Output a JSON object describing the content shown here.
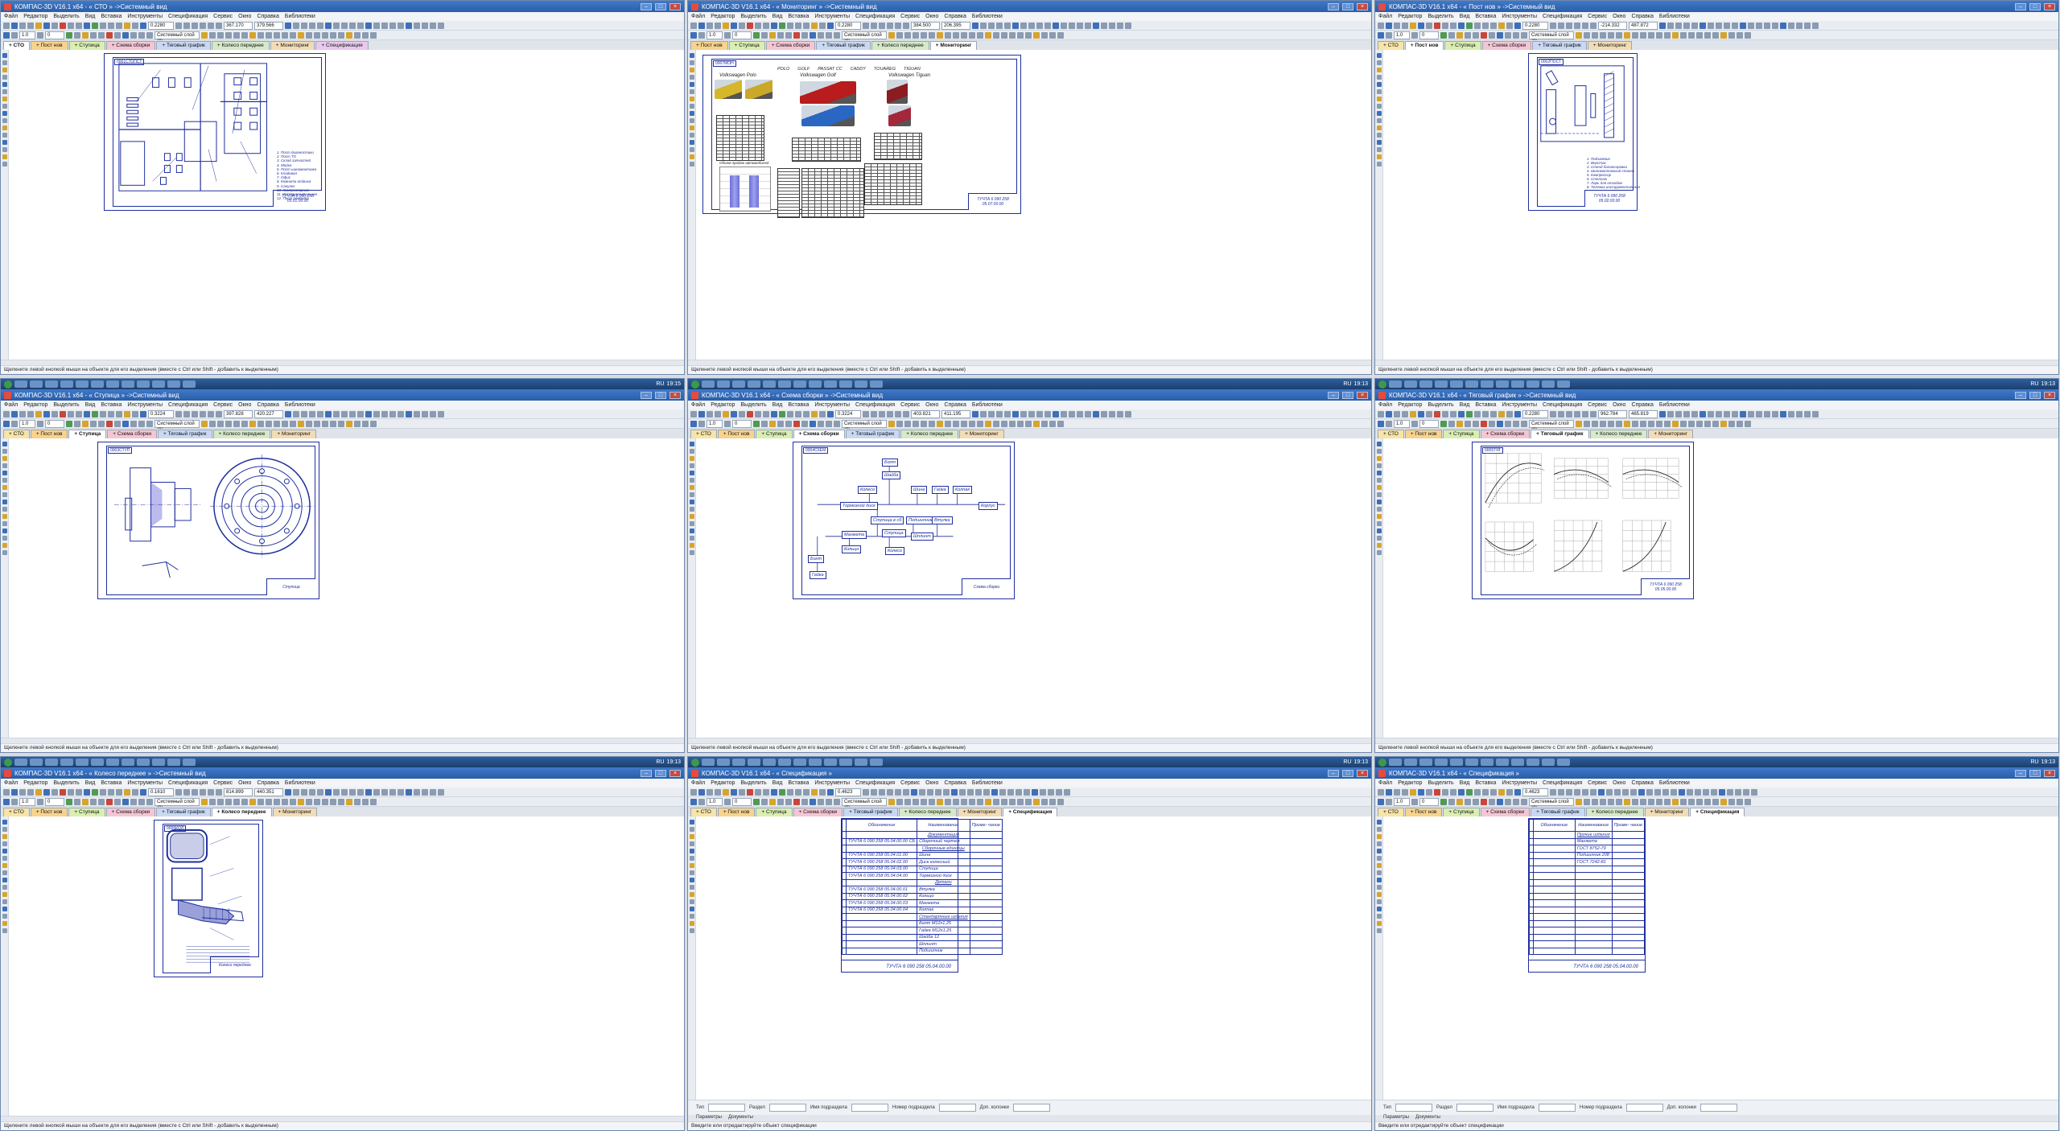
{
  "app": {
    "menu": [
      "Файл",
      "Редактор",
      "Выделить",
      "Вид",
      "Вставка",
      "Инструменты",
      "Спецификация",
      "Сервис",
      "Окно",
      "Справка",
      "Библиотеки"
    ],
    "status_select": "Щелкните левой кнопкой мыши на объекте для его выделения (вместе с Ctrl или Shift - добавить к выделенным)",
    "status_spec": "Введите или отредактируйте объект спецификации",
    "layer": "Системный слой (0)",
    "step": "1.0",
    "angle": "0",
    "lang": "RU",
    "tab_labels": [
      "+ СТО",
      "+ Пост нов",
      "+ Ступица",
      "+ Схема сборки",
      "+ Тяговый график",
      "+ Колесо переднее",
      "+ Мониторинг",
      "+ Спецификация"
    ],
    "spec_panel": [
      "Тип",
      "Раздел",
      "Имя подраздела",
      "Номер подраздела",
      "Доп. колонки"
    ],
    "spec_tabs": [
      "Параметры",
      "Документы"
    ],
    "colors": {
      "frame": "#1f2f9e",
      "title": "#2a5ea8",
      "taskbar": "#1c3f70"
    }
  },
  "windows": [
    {
      "title": "КОМПАС-3D V16.1 x64 - « СТО » ->Системный вид",
      "zoom": "0.2280",
      "coords": [
        "367.170",
        "379.566"
      ],
      "active": 0,
      "tabs": [
        0,
        1,
        2,
        3,
        4,
        5,
        6,
        7
      ],
      "type": "plan",
      "stamp": "ТУЧТА 6 090 258 05.01.00.00",
      "tag": "0001СТОПСТ",
      "status": "select",
      "taskbar": false,
      "plan_items": [
        "1. Пост диагностики",
        "2. Пост ТО",
        "3. Склад запчастей",
        "4. Мойка",
        "5. Пост шиномонтажа",
        "6. Кладовая",
        "7. Офис",
        "8. Комната отдыха",
        "9. Санузел",
        "10. Компрессорная",
        "11. Инструментальная",
        "12. Пост ремонта"
      ]
    },
    {
      "title": "КОМПАС-3D V16.1 x64 - « Мониторинг » ->Системный вид",
      "zoom": "0.2280",
      "coords": [
        "384.500",
        "206.395"
      ],
      "active": 6,
      "tabs": [
        1,
        2,
        3,
        4,
        5,
        6
      ],
      "type": "monitor",
      "stamp": "ТУЧТА 6 090 258 05.07.00.00",
      "tag": "0007МОН",
      "status": "select",
      "taskbar": false,
      "cars": [
        "Volkswagen Polo",
        "Volkswagen Golf",
        "Volkswagen Tiguan"
      ],
      "brands": [
        "POLO",
        "GOLF",
        "PASSAT CC",
        "CADDY",
        "TOUAREG",
        "TIGUAN"
      ],
      "chart_caption": "Объем продаж автомобилей"
    },
    {
      "title": "КОМПАС-3D V16.1 x64 - « Пост нов » ->Системный вид",
      "zoom": "0.2280",
      "coords": [
        "-214.332",
        "487.872"
      ],
      "active": 1,
      "tabs": [
        0,
        1,
        2,
        3,
        4,
        6
      ],
      "type": "post",
      "stamp": "ТУЧТА 6 090 258 05.02.00.00",
      "tag": "0002ПОСТ",
      "status": "select",
      "taskbar": false,
      "plan_items": [
        "1. Подъемник",
        "2. Верстак",
        "3. Стенд балансировки",
        "4. Шиномонтажный станок",
        "5. Компрессор",
        "6. Стеллаж",
        "7. Ларь для отходов",
        "8. Тележка инструментальная"
      ]
    },
    {
      "title": "КОМПАС-3D V16.1 x64 - « Ступица » ->Системный вид",
      "zoom": "0.3224",
      "coords": [
        "397.828",
        "420.227"
      ],
      "active": 2,
      "tabs": [
        0,
        1,
        2,
        3,
        4,
        5,
        6
      ],
      "type": "hub",
      "stamp": "Ступица",
      "tag": "0003СТУП",
      "status": "select",
      "taskbar": true,
      "clock": "19:15"
    },
    {
      "title": "КОМПАС-3D V16.1 x64 - « Схема сборки » ->Системный вид",
      "zoom": "0.3224",
      "coords": [
        "403.821",
        "411.195"
      ],
      "active": 3,
      "tabs": [
        0,
        1,
        2,
        3,
        4,
        5,
        6
      ],
      "type": "scheme",
      "stamp": "Схема сборки",
      "tag": "0004СХЕМ",
      "status": "select",
      "taskbar": true,
      "clock": "19:13",
      "nodes": [
        "Болт",
        "Шайба",
        "Колесо",
        "Шина",
        "Гайка",
        "Колпак",
        "Ступица в сб",
        "Ступица",
        "Подшипник",
        "Втулка",
        "Манжета",
        "Кольцо",
        "Тормозной диск",
        "Шплинт",
        "Болт",
        "Гайка",
        "Корпус",
        "Колесо"
      ]
    },
    {
      "title": "КОМПАС-3D V16.1 x64 - « Тяговый график » ->Системный вид",
      "zoom": "0.2280",
      "coords": [
        "962.784",
        "465.819"
      ],
      "active": 4,
      "tabs": [
        0,
        1,
        2,
        3,
        4,
        5,
        6
      ],
      "type": "graph",
      "stamp": "ТУЧТА 6 090 258 05.05.00.00",
      "tag": "0005ТЯГ",
      "status": "select",
      "taskbar": true,
      "clock": "19:13"
    },
    {
      "title": "КОМПАС-3D V16.1 x64 - « Колесо переднее » ->Системный вид",
      "zoom": "0.1610",
      "coords": [
        "814.899",
        "440.351"
      ],
      "active": 5,
      "tabs": [
        0,
        1,
        2,
        3,
        4,
        5,
        6
      ],
      "type": "wheel",
      "stamp": "Колесо переднее",
      "tag": "0006КОЛ",
      "status": "select",
      "taskbar": true,
      "clock": "19:13"
    },
    {
      "title": "КОМПАС-3D V16.1 x64 - « Спецификация »",
      "zoom": "0.4623",
      "coords": [
        "",
        ""
      ],
      "active": 7,
      "tabs": [
        0,
        1,
        2,
        3,
        4,
        5,
        6,
        7
      ],
      "type": "spec",
      "stamp": "ТУЧТА 6 090 258 05.04.00.00",
      "tag": "",
      "status": "spec",
      "taskbar": true,
      "clock": "19:13",
      "spec_head": [
        "Обозначение",
        "Наименование",
        "Приме- чание"
      ],
      "spec_rows": [
        [
          "",
          "Документация",
          ""
        ],
        [
          "ТУЧТА 6 090 258 05.04.00.00 СБ",
          "Сборочный чертеж",
          ""
        ],
        [
          "",
          "Сборочные единицы",
          ""
        ],
        [
          "ТУЧТА 6 090 258 05.04.01.00",
          "Шина",
          ""
        ],
        [
          "ТУЧТА 6 090 258 05.04.02.00",
          "Диск колесный",
          ""
        ],
        [
          "ТУЧТА 6 090 258 05.04.03.00",
          "Ступица",
          ""
        ],
        [
          "ТУЧТА 6 090 258 05.04.04.00",
          "Тормозной диск",
          ""
        ],
        [
          "",
          "Детали",
          ""
        ],
        [
          "ТУЧТА 6 090 258 05.04.00.01",
          "Втулка",
          ""
        ],
        [
          "ТУЧТА 6 090 258 05.04.00.02",
          "Кольцо",
          ""
        ],
        [
          "ТУЧТА 6 090 258 05.04.00.03",
          "Манжета",
          ""
        ],
        [
          "ТУЧТА 6 090 258 05.04.00.04",
          "Колпак",
          ""
        ],
        [
          "",
          "Стандартные изделия",
          ""
        ],
        [
          "",
          "Болт М12х1,25",
          ""
        ],
        [
          "",
          "Гайка М12х1,25",
          ""
        ],
        [
          "",
          "Шайба 12",
          ""
        ],
        [
          "",
          "Шплинт",
          ""
        ],
        [
          "",
          "Подшипник",
          ""
        ]
      ],
      "spec_stamp": "ТУЧТА 6 090 258 05.04.00.00"
    },
    {
      "title": "КОМПАС-3D V16.1 x64 - « Спецификация »",
      "zoom": "0.4623",
      "coords": [
        "",
        ""
      ],
      "active": 7,
      "tabs": [
        0,
        1,
        2,
        3,
        4,
        5,
        6,
        7
      ],
      "type": "spec2",
      "stamp": "ТУЧТА 6 090 258 05.04.00.00",
      "tag": "",
      "status": "spec",
      "taskbar": true,
      "clock": "19:13",
      "spec_head": [
        "Обозначение",
        "Наименование",
        "Приме- чание"
      ],
      "spec_rows": [
        [
          "",
          "Прочие изделия",
          ""
        ],
        [
          "",
          "Манжета",
          ""
        ],
        [
          "",
          "ГОСТ 8752-79",
          ""
        ],
        [
          "",
          "Подшипник 208",
          ""
        ],
        [
          "",
          "ГОСТ 7242-81",
          ""
        ]
      ],
      "spec_stamp": "ТУЧТА 6 090 258 05.04.00.00"
    }
  ]
}
